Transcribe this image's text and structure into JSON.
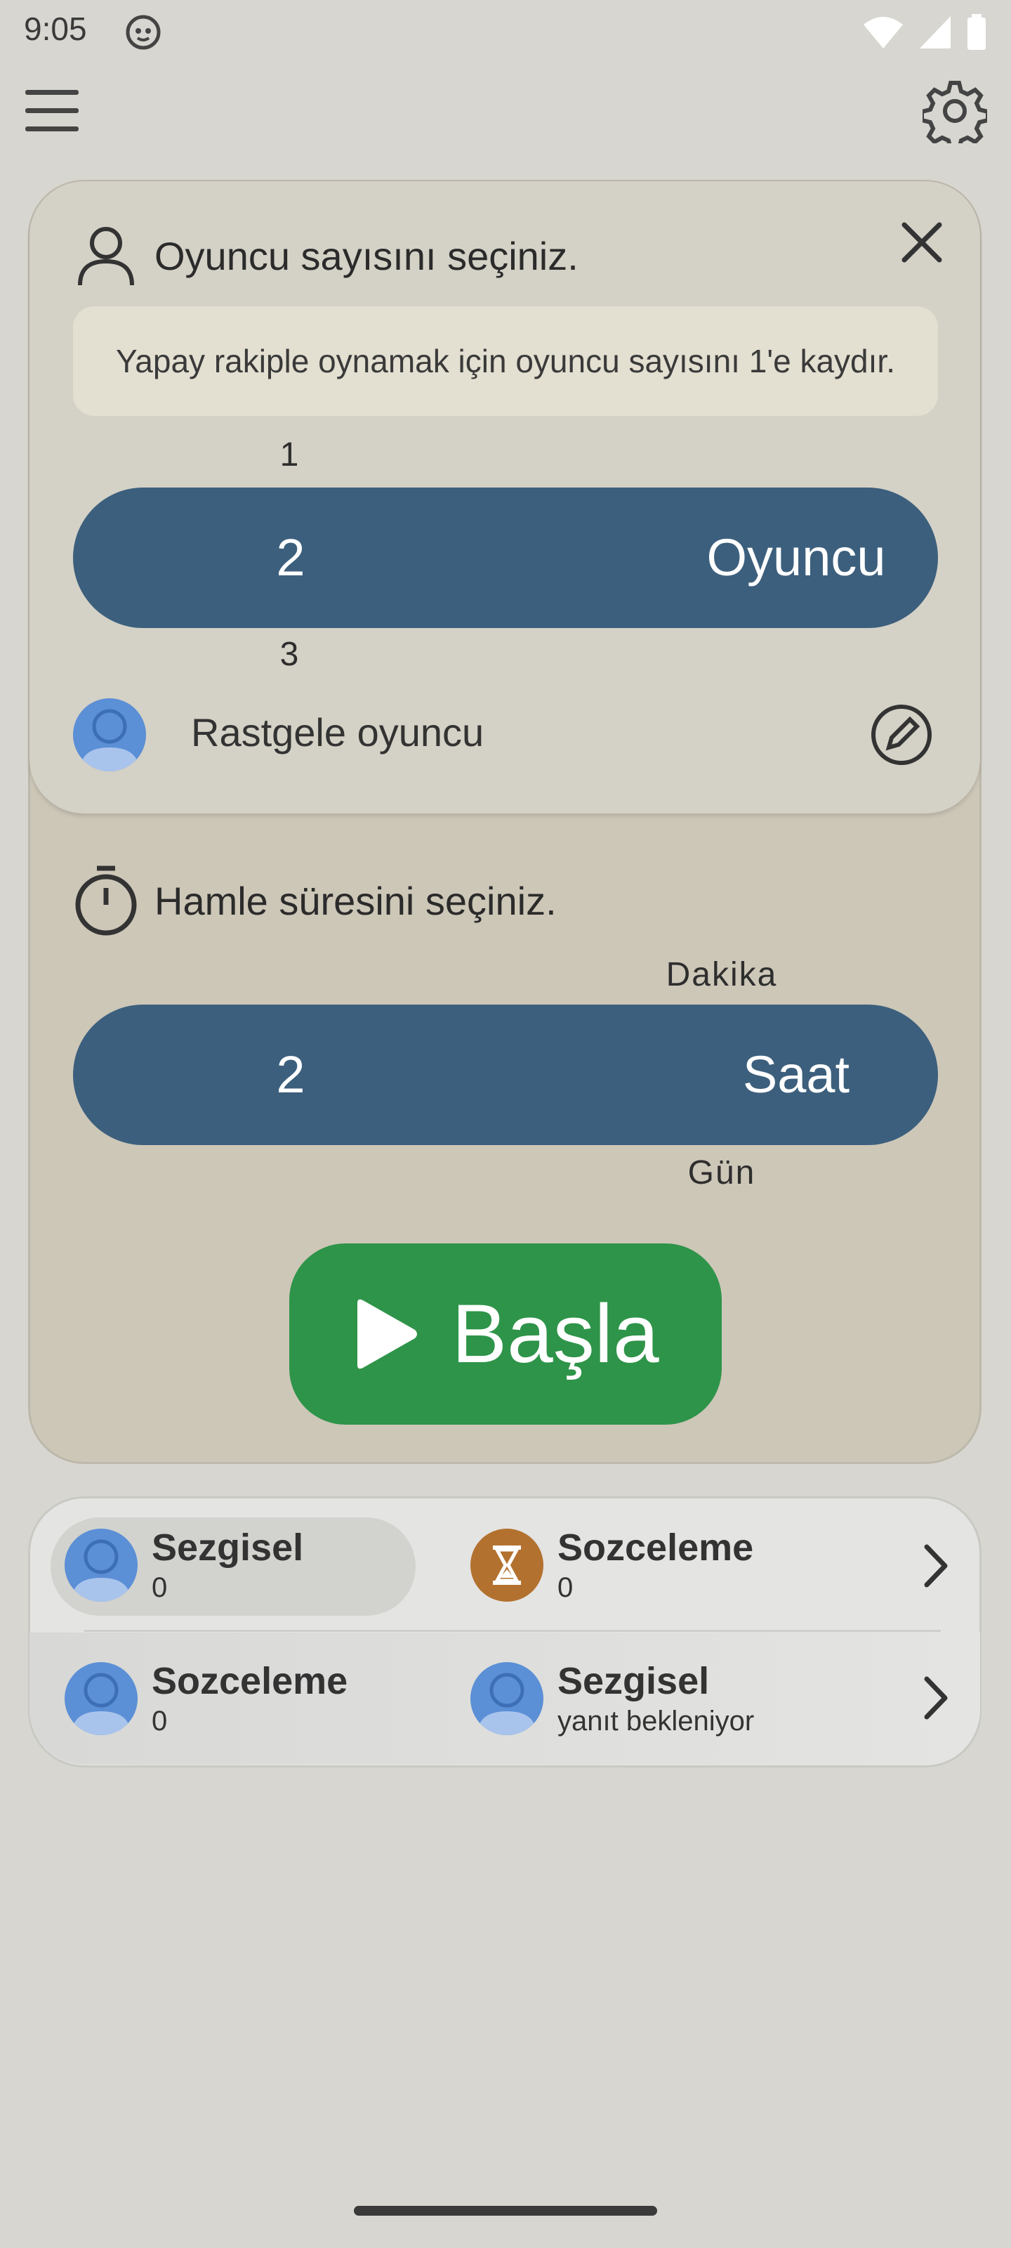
{
  "status_bar": {
    "time": "9:05"
  },
  "player_section": {
    "heading": "Oyuncu sayısını seçiniz.",
    "hint": "Yapay rakiple oynamak için oyuncu sayısını 1'e kaydır.",
    "picker": {
      "above": "1",
      "selected": "2",
      "unit": "Oyuncu",
      "below": "3"
    },
    "random_player_label": "Rastgele oyuncu"
  },
  "time_section": {
    "heading": "Hamle süresini seçiniz.",
    "picker": {
      "selected": "2",
      "unit_above": "Dakika",
      "unit": "Saat",
      "unit_below": "Gün"
    }
  },
  "start_button": {
    "label": "Başla"
  },
  "games": [
    {
      "left": {
        "name": "Sezgisel",
        "sub": "0",
        "avatar": "person-icon",
        "highlighted": true
      },
      "right": {
        "name": "Sozceleme",
        "sub": "0",
        "avatar": "hourglass-icon"
      }
    },
    {
      "left": {
        "name": "Sozceleme",
        "sub": "0",
        "avatar": "person-icon"
      },
      "right": {
        "name": "Sezgisel",
        "sub": "yanıt bekleniyor",
        "avatar": "person-icon"
      }
    }
  ],
  "colors": {
    "background": "#d7d6d0",
    "picker": "#3c5f7d",
    "start": "#2e9449",
    "avatar": "#5b8fd6",
    "hourglass_avatar": "#b3712f"
  }
}
